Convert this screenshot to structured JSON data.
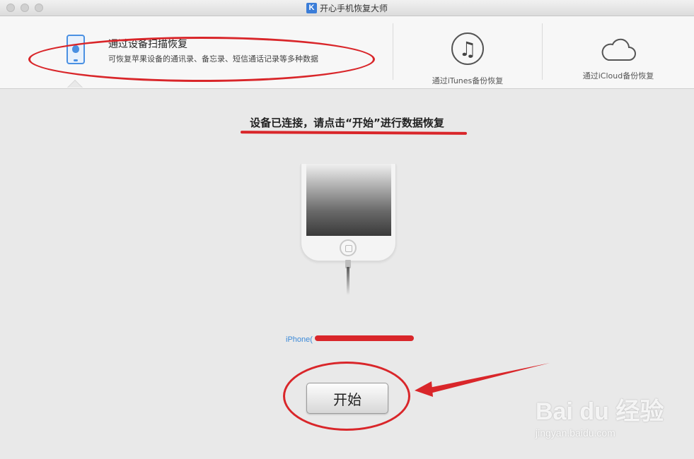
{
  "window": {
    "title": "开心手机恢复大师",
    "logo_letter": "K"
  },
  "tabs": {
    "device": {
      "title": "通过设备扫描恢复",
      "description": "可恢复苹果设备的通讯录、备忘录、短信通话记录等多种数据",
      "icon": "iphone-icon",
      "selected": true
    },
    "itunes": {
      "label": "通过iTunes备份恢复",
      "icon": "music-note-icon",
      "glyph": "♫"
    },
    "icloud": {
      "label": "通过iCloud备份恢复",
      "icon": "cloud-icon"
    }
  },
  "main": {
    "message": "设备已连接，请点击“开始”进行数据恢复",
    "device_name": "iPhone(",
    "start_button": "开始"
  },
  "watermark": {
    "logo": "Bai du 经验",
    "url": "jingyan.baidu.com"
  },
  "colors": {
    "annotation_red": "#d9262a",
    "accent_blue": "#4a90e2",
    "link_blue": "#3c8ad8"
  }
}
